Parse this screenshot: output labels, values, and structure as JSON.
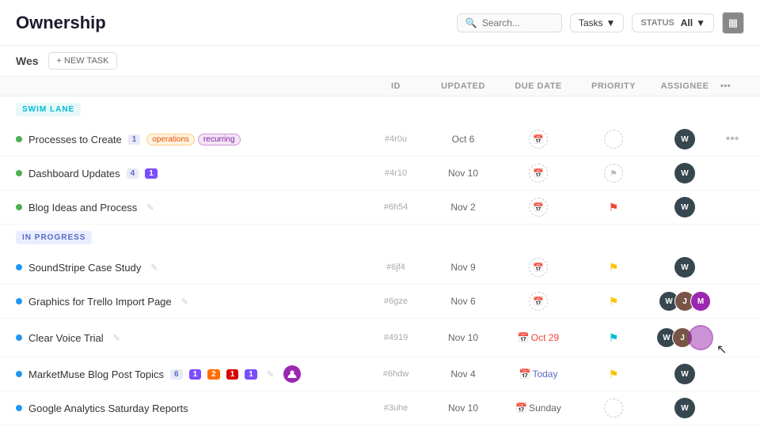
{
  "header": {
    "title": "Ownership",
    "search_placeholder": "Search...",
    "tasks_label": "Tasks",
    "status_label": "STATUS",
    "status_value": "All"
  },
  "sub_header": {
    "user": "Wes",
    "new_task_label": "+ NEW TASK"
  },
  "table": {
    "columns": [
      "",
      "ID",
      "UPDATED",
      "DUE DATE",
      "PRIORITY",
      "ASSIGNEE",
      ""
    ],
    "swim_lane_label": "SWIM LANE",
    "in_progress_label": "IN PROGRESS",
    "rows": [
      {
        "id": "swim1",
        "name": "Processes to Create",
        "badges": [
          "operations",
          "recurring"
        ],
        "counts": [
          "1"
        ],
        "task_id": "#4r0u",
        "updated": "Oct 6",
        "due_date": "",
        "due_display": "",
        "priority": "none",
        "assignee": "dark",
        "dot": "green",
        "edit": false,
        "calendar": false
      },
      {
        "id": "swim2",
        "name": "Dashboard Updates",
        "badges": [],
        "counts": [
          "4",
          "1p"
        ],
        "task_id": "#4r10",
        "updated": "Nov 10",
        "due_date": "",
        "due_display": "",
        "priority": "none",
        "assignee": "dark",
        "dot": "green",
        "edit": false,
        "calendar": false
      },
      {
        "id": "swim3",
        "name": "Blog Ideas and Process",
        "badges": [],
        "counts": [],
        "task_id": "#6h54",
        "updated": "Nov 2",
        "due_date": "",
        "due_display": "",
        "priority": "red",
        "assignee": "dark",
        "dot": "green",
        "edit": false,
        "calendar": false
      },
      {
        "id": "ip1",
        "name": "SoundStripe Case Study",
        "badges": [],
        "counts": [],
        "task_id": "#6jf4",
        "updated": "Nov 9",
        "due_date": "",
        "due_display": "",
        "priority": "yellow",
        "assignee": "dark",
        "dot": "blue",
        "edit": true,
        "calendar": false
      },
      {
        "id": "ip2",
        "name": "Graphics for Trello Import Page",
        "badges": [],
        "counts": [],
        "task_id": "#6gze",
        "updated": "Nov 6",
        "due_date": "",
        "due_display": "",
        "priority": "yellow",
        "assignee": "multi2",
        "dot": "blue",
        "edit": true,
        "calendar": false
      },
      {
        "id": "ip3",
        "name": "Clear Voice Trial",
        "badges": [],
        "counts": [],
        "task_id": "#4919",
        "updated": "Nov 10",
        "due_date": "Oct 29",
        "due_display": "Oct 29",
        "priority": "cyan",
        "assignee": "multi3",
        "dot": "blue",
        "edit": true,
        "calendar": true,
        "overdue": true
      },
      {
        "id": "ip4",
        "name": "MarketMuse Blog Post Topics",
        "badges": [],
        "counts": [
          "6",
          "1p",
          "2o",
          "1r",
          "1p2"
        ],
        "task_id": "#6hdw",
        "updated": "Nov 4",
        "due_date": "Today",
        "due_display": "Today",
        "priority": "yellow",
        "assignee": "dark",
        "dot": "blue",
        "edit": true,
        "calendar": true,
        "overdue": false
      },
      {
        "id": "ip5",
        "name": "Google Analytics Saturday Reports",
        "badges": [],
        "counts": [],
        "task_id": "#3uhe",
        "updated": "Nov 10",
        "due_date": "Sunday",
        "due_display": "Sunday",
        "priority": "none_dashed",
        "assignee": "dark",
        "dot": "blue",
        "edit": false,
        "calendar": true,
        "overdue": false
      }
    ]
  }
}
